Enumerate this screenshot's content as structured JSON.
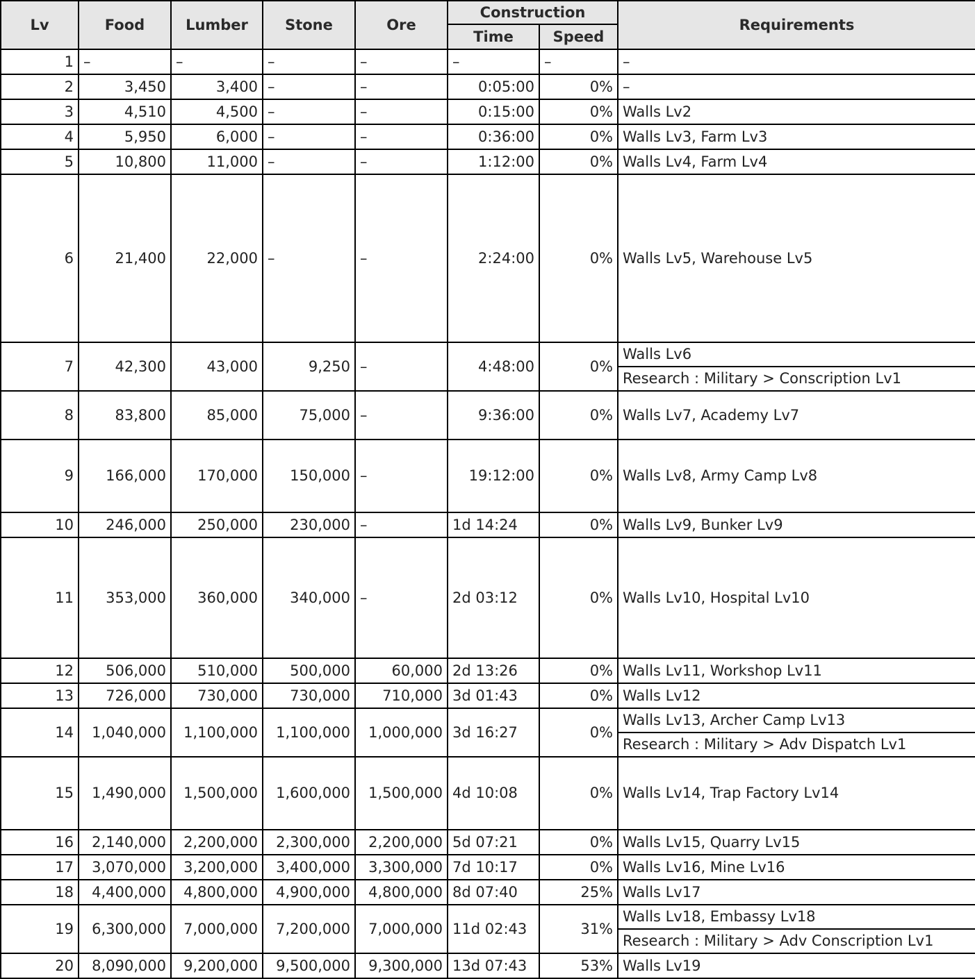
{
  "headers": {
    "lv": "Lv",
    "food": "Food",
    "lumber": "Lumber",
    "stone": "Stone",
    "ore": "Ore",
    "construction": "Construction",
    "time": "Time",
    "speed": "Speed",
    "requirements": "Requirements"
  },
  "rows": [
    {
      "lv": "1",
      "food": "–",
      "lumber": "–",
      "stone": "–",
      "ore": "–",
      "time": "–",
      "speed": "–",
      "req": [
        "–"
      ]
    },
    {
      "lv": "2",
      "food": "3,450",
      "lumber": "3,400",
      "stone": "–",
      "ore": "–",
      "time": "0:05:00",
      "speed": "0%",
      "req": [
        "–"
      ]
    },
    {
      "lv": "3",
      "food": "4,510",
      "lumber": "4,500",
      "stone": "–",
      "ore": "–",
      "time": "0:15:00",
      "speed": "0%",
      "req": [
        "Walls Lv2"
      ]
    },
    {
      "lv": "4",
      "food": "5,950",
      "lumber": "6,000",
      "stone": "–",
      "ore": "–",
      "time": "0:36:00",
      "speed": "0%",
      "req": [
        "Walls Lv3, Farm Lv3"
      ]
    },
    {
      "lv": "5",
      "food": "10,800",
      "lumber": "11,000",
      "stone": "–",
      "ore": "–",
      "time": "1:12:00",
      "speed": "0%",
      "req": [
        "Walls Lv4, Farm Lv4"
      ]
    },
    {
      "lv": "6",
      "food": "21,400",
      "lumber": "22,000",
      "stone": "–",
      "ore": "–",
      "time": "2:24:00",
      "speed": "0%",
      "req": [
        "Walls Lv5, Warehouse Lv5"
      ]
    },
    {
      "lv": "7",
      "food": "42,300",
      "lumber": "43,000",
      "stone": "9,250",
      "ore": "–",
      "time": "4:48:00",
      "speed": "0%",
      "req": [
        "Walls Lv6",
        "Research : Military > Conscription Lv1"
      ]
    },
    {
      "lv": "8",
      "food": "83,800",
      "lumber": "85,000",
      "stone": "75,000",
      "ore": "–",
      "time": "9:36:00",
      "speed": "0%",
      "req": [
        "Walls Lv7, Academy Lv7"
      ]
    },
    {
      "lv": "9",
      "food": "166,000",
      "lumber": "170,000",
      "stone": "150,000",
      "ore": "–",
      "time": "19:12:00",
      "speed": "0%",
      "req": [
        "Walls Lv8, Army Camp Lv8"
      ]
    },
    {
      "lv": "10",
      "food": "246,000",
      "lumber": "250,000",
      "stone": "230,000",
      "ore": "–",
      "time": "1d 14:24",
      "speed": "0%",
      "req": [
        "Walls Lv9, Bunker Lv9"
      ]
    },
    {
      "lv": "11",
      "food": "353,000",
      "lumber": "360,000",
      "stone": "340,000",
      "ore": "–",
      "time": "2d 03:12",
      "speed": "0%",
      "req": [
        "Walls Lv10, Hospital Lv10"
      ]
    },
    {
      "lv": "12",
      "food": "506,000",
      "lumber": "510,000",
      "stone": "500,000",
      "ore": "60,000",
      "time": "2d 13:26",
      "speed": "0%",
      "req": [
        "Walls Lv11, Workshop Lv11"
      ]
    },
    {
      "lv": "13",
      "food": "726,000",
      "lumber": "730,000",
      "stone": "730,000",
      "ore": "710,000",
      "time": "3d 01:43",
      "speed": "0%",
      "req": [
        "Walls Lv12"
      ]
    },
    {
      "lv": "14",
      "food": "1,040,000",
      "lumber": "1,100,000",
      "stone": "1,100,000",
      "ore": "1,000,000",
      "time": "3d 16:27",
      "speed": "0%",
      "req": [
        "Walls Lv13, Archer Camp Lv13",
        "Research : Military > Adv Dispatch Lv1"
      ]
    },
    {
      "lv": "15",
      "food": "1,490,000",
      "lumber": "1,500,000",
      "stone": "1,600,000",
      "ore": "1,500,000",
      "time": "4d 10:08",
      "speed": "0%",
      "req": [
        "Walls Lv14, Trap Factory Lv14"
      ]
    },
    {
      "lv": "16",
      "food": "2,140,000",
      "lumber": "2,200,000",
      "stone": "2,300,000",
      "ore": "2,200,000",
      "time": "5d 07:21",
      "speed": "0%",
      "req": [
        "Walls Lv15, Quarry Lv15"
      ]
    },
    {
      "lv": "17",
      "food": "3,070,000",
      "lumber": "3,200,000",
      "stone": "3,400,000",
      "ore": "3,300,000",
      "time": "7d 10:17",
      "speed": "0%",
      "req": [
        "Walls Lv16, Mine Lv16"
      ]
    },
    {
      "lv": "18",
      "food": "4,400,000",
      "lumber": "4,800,000",
      "stone": "4,900,000",
      "ore": "4,800,000",
      "time": "8d 07:40",
      "speed": "25%",
      "req": [
        "Walls Lv17"
      ]
    },
    {
      "lv": "19",
      "food": "6,300,000",
      "lumber": "7,000,000",
      "stone": "7,200,000",
      "ore": "7,000,000",
      "time": "11d 02:43",
      "speed": "31%",
      "req": [
        "Walls Lv18, Embassy Lv18",
        "Research : Military > Adv Conscription Lv1"
      ]
    },
    {
      "lv": "20",
      "food": "8,090,000",
      "lumber": "9,200,000",
      "stone": "9,500,000",
      "ore": "9,300,000",
      "time": "13d 07:43",
      "speed": "53%",
      "req": [
        "Walls Lv19"
      ]
    }
  ]
}
